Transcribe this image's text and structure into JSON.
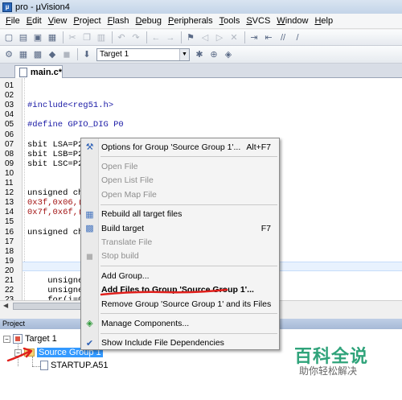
{
  "window": {
    "title": "pro - µVision4"
  },
  "menubar": [
    {
      "label": "File",
      "ul": "F",
      "rest": "ile"
    },
    {
      "label": "Edit",
      "ul": "E",
      "rest": "dit"
    },
    {
      "label": "View",
      "ul": "V",
      "rest": "iew"
    },
    {
      "label": "Project",
      "ul": "P",
      "rest": "roject"
    },
    {
      "label": "Flash",
      "ul": "F",
      "rest": "lash"
    },
    {
      "label": "Debug",
      "ul": "D",
      "rest": "ebug"
    },
    {
      "label": "Peripherals",
      "ul": "P",
      "rest": "eripherals"
    },
    {
      "label": "Tools",
      "ul": "T",
      "rest": "ools"
    },
    {
      "label": "SVCS",
      "ul": "S",
      "rest": "VCS"
    },
    {
      "label": "Window",
      "ul": "W",
      "rest": "indow"
    },
    {
      "label": "Help",
      "ul": "H",
      "rest": "elp"
    }
  ],
  "toolbar2": {
    "target": "Target 1"
  },
  "editor": {
    "tab": "main.c*",
    "lines": [
      {
        "n": "01",
        "code": "",
        "color": "black"
      },
      {
        "n": "02",
        "code": "",
        "color": "black"
      },
      {
        "n": "03",
        "code": "#include<reg51.h>",
        "color": "blue"
      },
      {
        "n": "04",
        "code": "",
        "color": "black"
      },
      {
        "n": "05",
        "code": "#define GPIO_DIG P0",
        "color": "blue"
      },
      {
        "n": "06",
        "code": "",
        "color": "black"
      },
      {
        "n": "07",
        "code": "sbit LSA=P2",
        "color": "black"
      },
      {
        "n": "08",
        "code": "sbit LSB=P2",
        "color": "black"
      },
      {
        "n": "09",
        "code": "sbit LSC=P2",
        "color": "black"
      },
      {
        "n": "10",
        "code": "",
        "color": "black"
      },
      {
        "n": "11",
        "code": "",
        "color": "black"
      },
      {
        "n": "12",
        "code": "unsigned ch",
        "color": "black"
      },
      {
        "n": "13",
        "code": "0x3f,0x06,(",
        "color": "brown"
      },
      {
        "n": "14",
        "code": "0x7f,0x6f,(",
        "color": "brown"
      },
      {
        "n": "15",
        "code": "",
        "color": "black"
      },
      {
        "n": "16",
        "code": "unsigned ch",
        "color": "black"
      },
      {
        "n": "17",
        "code": "",
        "color": "black"
      },
      {
        "n": "18",
        "code": "",
        "color": "black"
      },
      {
        "n": "19",
        "code": "",
        "color": "black"
      },
      {
        "n": "20",
        "code": "",
        "color": "black"
      },
      {
        "n": "21",
        "code": "    unsigne",
        "color": "black"
      },
      {
        "n": "22",
        "code": "    unsigne",
        "color": "black"
      },
      {
        "n": "23",
        "code": "    for(i=0",
        "color": "black"
      }
    ]
  },
  "project": {
    "header": "Project",
    "tree": {
      "target": "Target 1",
      "group": "Source Group 1",
      "file": "STARTUP.A51"
    }
  },
  "context_menu": {
    "items": [
      {
        "label": "Options for Group 'Source Group 1'...",
        "shortcut": "Alt+F7",
        "icon": "options-icon",
        "enabled": true
      },
      {
        "separator": true
      },
      {
        "label": "Open File",
        "icon": "",
        "enabled": false
      },
      {
        "label": "Open List File",
        "icon": "",
        "enabled": false
      },
      {
        "label": "Open Map File",
        "icon": "",
        "enabled": false
      },
      {
        "separator": true
      },
      {
        "label": "Rebuild all target files",
        "icon": "rebuild-icon",
        "enabled": true
      },
      {
        "label": "Build target",
        "shortcut": "F7",
        "icon": "build-icon",
        "enabled": true
      },
      {
        "label": "Translate File",
        "icon": "",
        "enabled": false
      },
      {
        "label": "Stop build",
        "icon": "stop-build-icon",
        "enabled": false
      },
      {
        "separator": true
      },
      {
        "label": "Add Group...",
        "icon": "",
        "enabled": true
      },
      {
        "label": "Add Files to Group 'Source Group 1'...",
        "icon": "",
        "enabled": true,
        "highlight": true
      },
      {
        "label": "Remove Group 'Source Group 1' and its Files",
        "icon": "",
        "enabled": true
      },
      {
        "separator": true
      },
      {
        "label": "Manage Components...",
        "icon": "components-icon",
        "enabled": true
      },
      {
        "separator": true
      },
      {
        "label": "Show Include File Dependencies",
        "icon": "check-icon",
        "enabled": true
      }
    ]
  },
  "watermark": {
    "title": "百科全说",
    "subtitle": "助你轻松解决"
  },
  "colors": {
    "annotation_red": "#e0201c",
    "watermark_green": "#2fa37a",
    "selection_blue": "#3399ff"
  }
}
